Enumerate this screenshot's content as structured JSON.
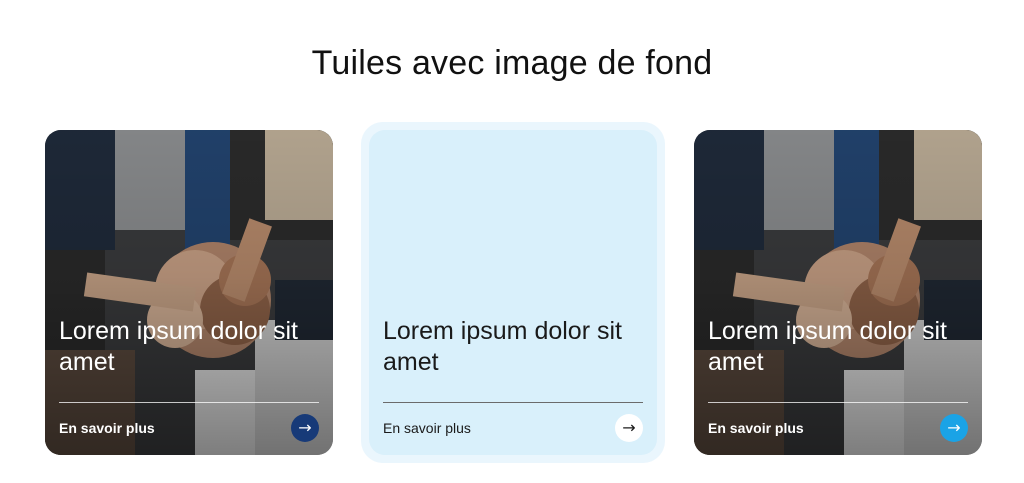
{
  "page": {
    "title": "Tuiles avec image de fond"
  },
  "tiles": [
    {
      "heading": "Lorem ipsum dolor sit amet",
      "link_label": "En savoir plus",
      "arrow_glyph": "→",
      "arrow_color": "#173a78",
      "background": "photo-stacked-hands"
    },
    {
      "heading": "Lorem ipsum dolor sit amet",
      "link_label": "En savoir plus",
      "arrow_glyph": "→",
      "arrow_color": "#ffffff",
      "background_color": "#d9f0fb"
    },
    {
      "heading": "Lorem ipsum dolor sit amet",
      "link_label": "En savoir plus",
      "arrow_glyph": "→",
      "arrow_color": "#1aa3e6",
      "background": "photo-stacked-hands"
    }
  ],
  "icons": {
    "arrow": "arrow-right-icon"
  }
}
